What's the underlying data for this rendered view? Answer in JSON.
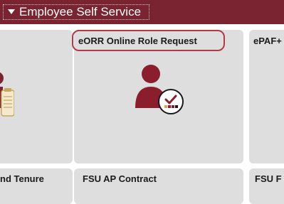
{
  "header": {
    "section_title": "Employee Self Service"
  },
  "tiles": [
    {
      "title": ""
    },
    {
      "title": "eORR Online Role Request"
    },
    {
      "title": "ePAF+"
    },
    {
      "title": "nd Tenure"
    },
    {
      "title": "FSU AP Contract"
    },
    {
      "title": "FSU F"
    }
  ],
  "icons": {
    "clipboard": "clipboard-person-icon",
    "role_request": "person-checkmark-icon"
  },
  "colors": {
    "header_bg": "#7a2431",
    "accent": "#8b1e2d",
    "tile_bg": "#dedede",
    "focus_ring": "#b23a48"
  }
}
